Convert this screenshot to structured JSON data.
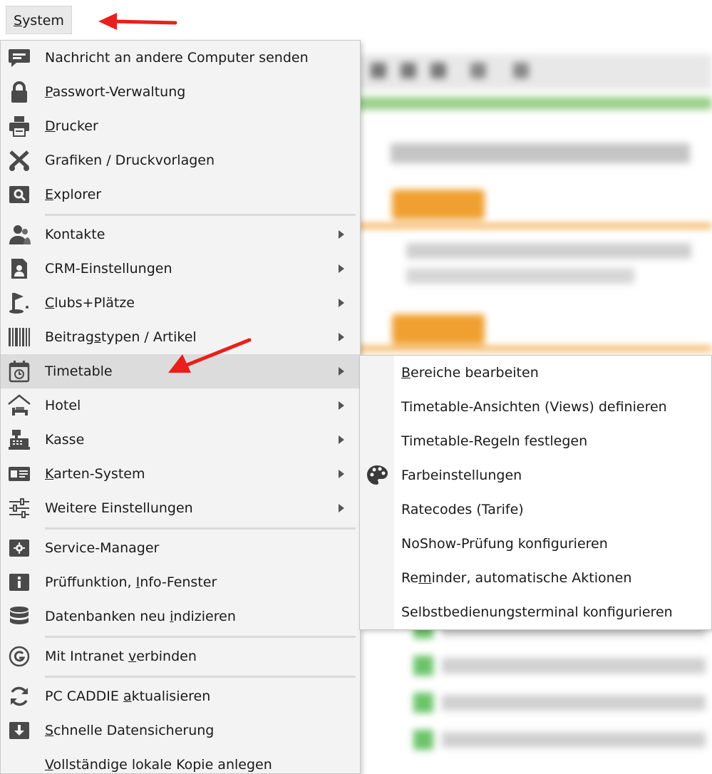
{
  "menubar": {
    "system": {
      "pre": "",
      "ul": "S",
      "post": "ystem"
    }
  },
  "menu": {
    "items": [
      {
        "pre": "",
        "ul": "",
        "post": "Nachricht an andere Computer senden",
        "icon": "message-icon",
        "submenu": false
      },
      {
        "pre": "",
        "ul": "P",
        "post": "asswort-Verwaltung",
        "icon": "lock-icon",
        "submenu": false
      },
      {
        "pre": "",
        "ul": "D",
        "post": "rucker",
        "icon": "printer-icon",
        "submenu": false
      },
      {
        "pre": "",
        "ul": "",
        "post": "Grafiken / Druckvorlagen",
        "icon": "scissors-icon",
        "submenu": false
      },
      {
        "pre": "",
        "ul": "E",
        "post": "xplorer",
        "icon": "explorer-icon",
        "submenu": false
      },
      {
        "pre": "",
        "ul": "",
        "post": "Kontakte",
        "icon": "contacts-icon",
        "submenu": true
      },
      {
        "pre": "",
        "ul": "",
        "post": "CRM-Einstellungen",
        "icon": "crm-icon",
        "submenu": true
      },
      {
        "pre": "",
        "ul": "C",
        "post": "lubs+Plätze",
        "icon": "clubs-icon",
        "submenu": true
      },
      {
        "pre": "Beitrag",
        "ul": "s",
        "post": "typen / Artikel",
        "icon": "barcode-icon",
        "submenu": true
      },
      {
        "pre": "",
        "ul": "",
        "post": "Timetable",
        "icon": "timetable-icon",
        "submenu": true
      },
      {
        "pre": "",
        "ul": "",
        "post": "Hotel",
        "icon": "hotel-icon",
        "submenu": true
      },
      {
        "pre": "",
        "ul": "",
        "post": "Kasse",
        "icon": "cash-register-icon",
        "submenu": true
      },
      {
        "pre": "",
        "ul": "K",
        "post": "arten-System",
        "icon": "card-icon",
        "submenu": true
      },
      {
        "pre": "",
        "ul": "",
        "post": "Weitere Einstellungen",
        "icon": "sliders-icon",
        "submenu": true
      },
      {
        "pre": "",
        "ul": "",
        "post": "Service-Manager",
        "icon": "gear-icon",
        "submenu": false
      },
      {
        "pre": "Prüffunktion, ",
        "ul": "I",
        "post": "nfo-Fenster",
        "icon": "info-icon",
        "submenu": false
      },
      {
        "pre": "Datenbanken neu ",
        "ul": "i",
        "post": "ndizieren",
        "icon": "database-icon",
        "submenu": false
      },
      {
        "pre": "Mit Intranet ",
        "ul": "v",
        "post": "erbinden",
        "icon": "intranet-icon",
        "submenu": false
      },
      {
        "pre": "PC CADDIE ",
        "ul": "a",
        "post": "ktualisieren",
        "icon": "refresh-icon",
        "submenu": false
      },
      {
        "pre": "",
        "ul": "S",
        "post": "chnelle Datensicherung",
        "icon": "download-icon",
        "submenu": false
      },
      {
        "pre": "",
        "ul": "V",
        "post": "ollständige lokale Kopie anlegen",
        "icon": "",
        "submenu": false
      }
    ]
  },
  "submenu": {
    "items": [
      {
        "pre": "",
        "ul": "B",
        "post": "ereiche bearbeiten"
      },
      {
        "pre": "",
        "ul": "",
        "post": "Timetable-Ansichten (Views) definieren"
      },
      {
        "pre": "",
        "ul": "",
        "post": "Timetable-Regeln festlegen"
      },
      {
        "pre": "",
        "ul": "",
        "post": "Farbeinstellungen"
      },
      {
        "pre": "",
        "ul": "",
        "post": "Ratecodes (Tarife)"
      },
      {
        "pre": "",
        "ul": "",
        "post": "NoShow-Prüfung konfigurieren"
      },
      {
        "pre": "Re",
        "ul": "m",
        "post": "inder, automatische Aktionen"
      },
      {
        "pre": "",
        "ul": "",
        "post": "Selbstbedienungsterminal konfigurieren"
      }
    ]
  },
  "colors": {
    "annotation_red": "#e8201c",
    "highlight": "#dcdcdc",
    "menu_bg": "#f3f3f3"
  }
}
